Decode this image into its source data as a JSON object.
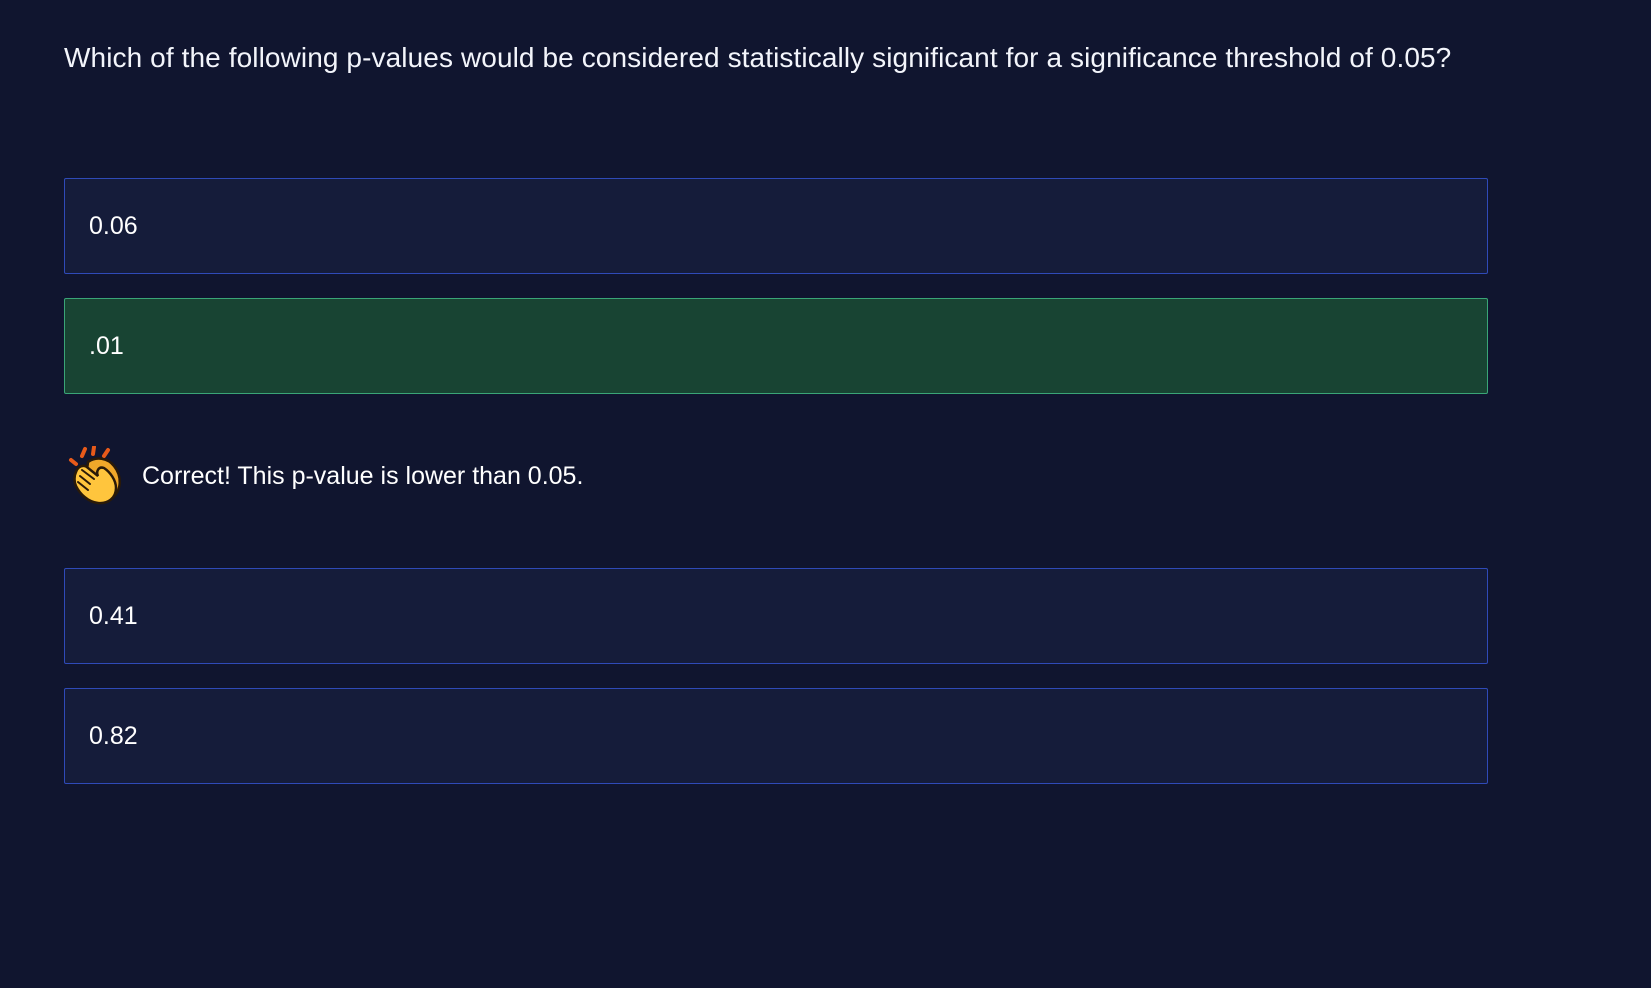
{
  "question": {
    "text": "Which of the following p-values would be considered statistically significant for a significance threshold of 0.05?"
  },
  "options": [
    {
      "label": "0.06",
      "state": "default"
    },
    {
      "label": ".01",
      "state": "correct"
    },
    {
      "label": "0.41",
      "state": "default"
    },
    {
      "label": "0.82",
      "state": "default"
    }
  ],
  "feedback": {
    "icon": "clapping-hands-icon",
    "text": "Correct! This p-value is lower than 0.05."
  },
  "colors": {
    "background": "#10152f",
    "option_bg": "#151c3a",
    "option_border": "#2f4ab8",
    "correct_bg": "#184433",
    "correct_border": "#3aa577"
  }
}
